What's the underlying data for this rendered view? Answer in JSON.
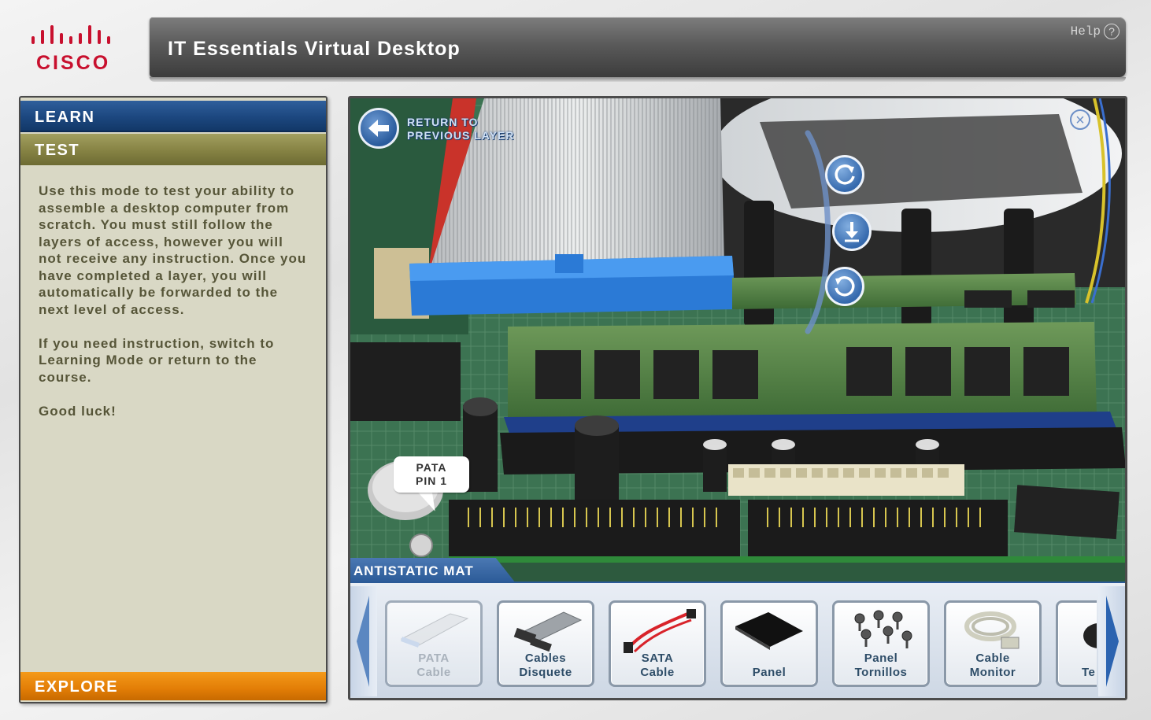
{
  "header": {
    "brand": "CISCO",
    "title": "IT Essentials Virtual Desktop",
    "help_label": "Help",
    "help_icon": "question-icon"
  },
  "left_panel": {
    "tabs": {
      "learn": "LEARN",
      "test": "TEST",
      "explore": "EXPLORE"
    },
    "instructions": {
      "p1": "Use this mode to test your ability to assemble a desktop computer from scratch. You must still follow the layers of access, however you will not receive any instruction. Once you have completed a layer, you will automatically be forwarded to the next level of access.",
      "p2": "If you need instruction, switch to Learning Mode or return to the course.",
      "p3": "Good luck!"
    }
  },
  "main_view": {
    "return_label_1": "RETURN TO",
    "return_label_2": "PREVIOUS LAYER",
    "close_icon": "close-icon",
    "controls": [
      "rotate-cw-icon",
      "download-icon",
      "rotate-ccw-icon"
    ],
    "callout_line1": "PATA",
    "callout_line2": "PIN 1"
  },
  "tray": {
    "tab_label": "ANTISTATIC MAT",
    "items": [
      {
        "line1": "PATA",
        "line2": "Cable",
        "enabled": false
      },
      {
        "line1": "Cables",
        "line2": "Disquete",
        "enabled": true
      },
      {
        "line1": "SATA",
        "line2": "Cable",
        "enabled": true
      },
      {
        "line1": "",
        "line2": "Panel",
        "enabled": true
      },
      {
        "line1": "Panel",
        "line2": "Tornillos",
        "enabled": true
      },
      {
        "line1": "Cable",
        "line2": "Monitor",
        "enabled": true
      },
      {
        "line1": "",
        "line2": "Te",
        "enabled": true
      }
    ]
  },
  "colors": {
    "learn_tab": "#1c477f",
    "test_tab": "#858243",
    "explore_tab": "#e27d06",
    "panel_bg": "#d9d8c5",
    "cisco_red": "#c8102e",
    "accent_blue": "#2b5a97"
  }
}
